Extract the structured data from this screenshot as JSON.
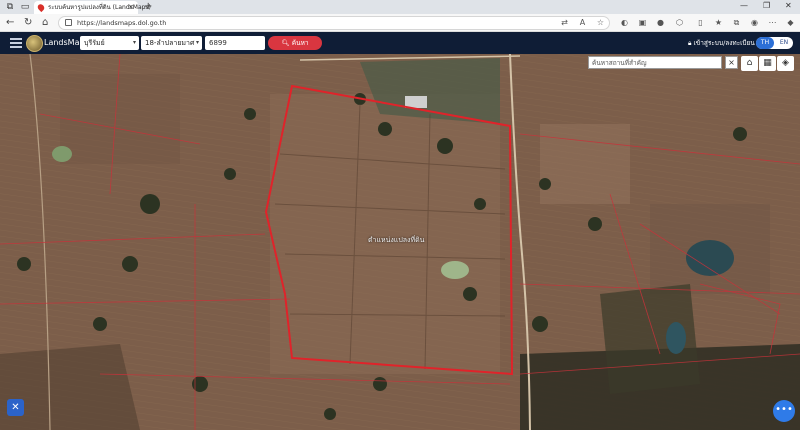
{
  "browser": {
    "tab_title": "ระบบค้นหารูปแปลงที่ดิน (LandsMaps)",
    "url": "https://landsmaps.dol.go.th",
    "new_tab_symbol": "+",
    "tab_close_symbol": "×"
  },
  "header": {
    "brand": "LandsMaps",
    "province": "บุรีรัมย์",
    "district": "18-ลำปลายมาศ",
    "parcel_number": "6899",
    "search_button": "ค้นหา",
    "login_link": "เข้าสู่ระบบ/ลงทะเบียน",
    "lang_th": "TH",
    "lang_en": "EN"
  },
  "map": {
    "search_placeholder": "ค้นหาสถานที่สำคัญ",
    "close_symbol": "×",
    "parcel_label": "ตำแหน่งแปลงที่ดิน",
    "boundary_color": "#e0232a",
    "more_symbol": "•••"
  }
}
